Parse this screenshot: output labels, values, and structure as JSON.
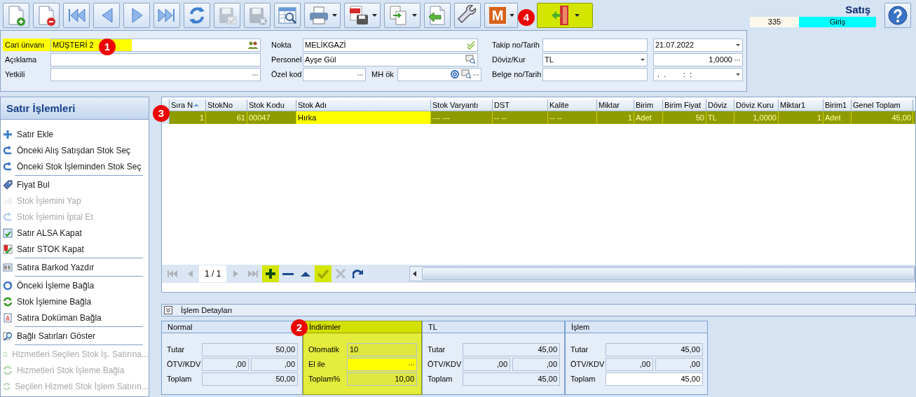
{
  "toolbar": {
    "buttons": [
      {
        "kind": "page-add",
        "disabled": false,
        "dropdown": false,
        "highlighted": false
      },
      {
        "kind": "page-remove",
        "disabled": false,
        "dropdown": false,
        "highlighted": false
      },
      {
        "kind": "first",
        "disabled": false,
        "dropdown": false,
        "highlighted": false
      },
      {
        "kind": "prev",
        "disabled": false,
        "dropdown": false,
        "highlighted": false
      },
      {
        "kind": "next",
        "disabled": false,
        "dropdown": false,
        "highlighted": false
      },
      {
        "kind": "last",
        "disabled": false,
        "dropdown": false,
        "highlighted": false
      },
      {
        "kind": "refresh",
        "disabled": false,
        "dropdown": false,
        "highlighted": false
      },
      {
        "kind": "save",
        "disabled": true,
        "dropdown": false,
        "highlighted": false
      },
      {
        "kind": "save-cancel",
        "disabled": true,
        "dropdown": false,
        "highlighted": false
      },
      {
        "kind": "table-search",
        "disabled": false,
        "dropdown": false,
        "highlighted": false
      },
      {
        "kind": "printer",
        "disabled": false,
        "dropdown": true,
        "highlighted": false
      },
      {
        "kind": "pdf",
        "disabled": false,
        "dropdown": true,
        "highlighted": false
      },
      {
        "kind": "copy",
        "disabled": false,
        "dropdown": true,
        "highlighted": false
      },
      {
        "kind": "back",
        "disabled": false,
        "dropdown": false,
        "highlighted": false
      },
      {
        "kind": "wrench",
        "disabled": false,
        "dropdown": false,
        "highlighted": false
      },
      {
        "kind": "letter",
        "text": "M",
        "disabled": false,
        "dropdown": true,
        "highlighted": false
      },
      {
        "kind": "exit",
        "disabled": false,
        "dropdown": true,
        "highlighted": true
      }
    ]
  },
  "document": {
    "title": "Satış",
    "number": "335",
    "mode": "Giriş"
  },
  "header": {
    "columns": [
      [
        [
          {
            "label": "Cari ünvanı",
            "highlighted": true,
            "inputs": [
              {
                "kind": "text",
                "value": "MÜŞTERİ 2",
                "accessories": [
                  {
                    "kind": "people"
                  }
                ]
              }
            ]
          }
        ],
        [
          {
            "label": "Açıklama",
            "highlighted": false,
            "inputs": [
              {
                "kind": "text"
              }
            ]
          }
        ],
        [
          {
            "label": "Yetkili",
            "highlighted": false,
            "inputs": [
              {
                "kind": "text",
                "accessories": [
                  {
                    "kind": "ellipsis"
                  }
                ]
              }
            ]
          }
        ]
      ],
      [
        [
          {
            "label": "Nokta",
            "highlighted": false,
            "inputs": [
              {
                "kind": "text",
                "value": "MELİKGAZİ",
                "accessories": [
                  {
                    "kind": "check"
                  }
                ]
              }
            ]
          }
        ],
        [
          {
            "label": "Personel",
            "highlighted": false,
            "inputs": [
              {
                "kind": "text",
                "value": "Ayşe Gül",
                "accessories": [
                  {
                    "kind": "card-search"
                  }
                ]
              }
            ]
          }
        ],
        [
          {
            "label": "Özel kod",
            "highlighted": false,
            "inputs": [
              {
                "kind": "text",
                "accessories": [
                  {
                    "kind": "ellipsis"
                  }
                ]
              }
            ]
          },
          {
            "label": "MH ök",
            "highlighted": false,
            "inputs": [
              {
                "kind": "text",
                "accessories": [
                  {
                    "kind": "at"
                  },
                  {
                    "kind": "card-search"
                  },
                  {
                    "kind": "ellipsis"
                  }
                ]
              }
            ]
          }
        ]
      ],
      [
        [
          {
            "label": "Takip no/Tarih",
            "highlighted": false,
            "inputs": [
              {
                "kind": "text"
              },
              {
                "kind": "text",
                "value": "21.07.2022",
                "accessories": [
                  {
                    "kind": "dropdown"
                  }
                ]
              }
            ]
          }
        ],
        [
          {
            "label": "Döviz/Kur",
            "highlighted": false,
            "inputs": [
              {
                "kind": "text",
                "value": "TL",
                "accessories": [
                  {
                    "kind": "dropdown"
                  }
                ]
              },
              {
                "kind": "number",
                "value": "1,0000",
                "accessories": [
                  {
                    "kind": "ellipsis"
                  }
                ]
              }
            ]
          }
        ],
        [
          {
            "label": "Belge no/Tarih",
            "highlighted": false,
            "inputs": [
              {
                "kind": "text"
              },
              {
                "kind": "text",
                "value": " .  .        :  :",
                "accessories": [
                  {
                    "kind": "dropdown"
                  }
                ]
              }
            ]
          }
        ]
      ]
    ]
  },
  "sidebar": {
    "title": "Satır İşlemleri",
    "items": [
      {
        "label": "Satır Ekle",
        "kind": "plus",
        "disabled": false,
        "separator_after": false
      },
      {
        "label": "Önceki Alış Satışdan Stok Seç",
        "kind": "return",
        "disabled": false,
        "separator_after": false
      },
      {
        "label": "Önceki Stok İşleminden Stok Seç",
        "kind": "return",
        "disabled": false,
        "separator_after": true
      },
      {
        "label": "Fiyat Bul",
        "kind": "tag",
        "disabled": false,
        "separator_after": false
      },
      {
        "label": "Stok İşlemini Yap",
        "kind": "forward",
        "disabled": true,
        "separator_after": false
      },
      {
        "label": "Stok İşlemini İptal Et",
        "kind": "return",
        "disabled": true,
        "separator_after": false
      },
      {
        "label": "Satır ALSA Kapat",
        "kind": "doc-check",
        "disabled": false,
        "separator_after": false
      },
      {
        "label": "Satır STOK Kapat",
        "kind": "flag-check",
        "disabled": false,
        "separator_after": true
      },
      {
        "label": "Satıra Barkod Yazdır",
        "kind": "barcode",
        "disabled": false,
        "separator_after": true
      },
      {
        "label": "Önceki İşleme Bağla",
        "kind": "cycle",
        "disabled": false,
        "separator_after": false
      },
      {
        "label": "Stok İşlemine Bağla",
        "kind": "swap",
        "disabled": false,
        "separator_after": false
      },
      {
        "label": "Satıra Doküman Bağla",
        "kind": "document",
        "disabled": false,
        "separator_after": true
      },
      {
        "label": "Bağlı Satırları Göster",
        "kind": "magnifier",
        "disabled": false,
        "separator_after": true
      },
      {
        "label": "Hizmetleri Seçilen Stok İş. Satırına...",
        "kind": "swap",
        "disabled": true,
        "separator_after": false
      },
      {
        "label": "Hizmetleri Stok İşleme Bağla",
        "kind": "swap",
        "disabled": true,
        "separator_after": false
      },
      {
        "label": "Seçilen Hizmeti Stok İşlem Satırın...",
        "kind": "swap",
        "disabled": true,
        "separator_after": false
      }
    ]
  },
  "grid": {
    "columns": [
      {
        "label": "Sıra N",
        "sorted": true
      },
      {
        "label": "StokNo",
        "sorted": false
      },
      {
        "label": "Stok Kodu",
        "sorted": false
      },
      {
        "label": "Stok Adı",
        "sorted": false
      },
      {
        "label": "Stok Varyantı",
        "sorted": false
      },
      {
        "label": "DST",
        "sorted": false
      },
      {
        "label": "Kalite",
        "sorted": false
      },
      {
        "label": "Miktar",
        "sorted": false
      },
      {
        "label": "Birim",
        "sorted": false
      },
      {
        "label": "Birim Fiyat",
        "sorted": false
      },
      {
        "label": "Döviz",
        "sorted": false
      },
      {
        "label": "Döviz Kuru",
        "sorted": false
      },
      {
        "label": "Miktar1",
        "sorted": false
      },
      {
        "label": "Birim1",
        "sorted": false
      },
      {
        "label": "Genel Toplam",
        "sorted": false
      }
    ],
    "rows": [
      {
        "selected": true,
        "cells": [
          {
            "text": "1",
            "focused": false
          },
          {
            "text": "61",
            "focused": false
          },
          {
            "text": "00047",
            "focused": false
          },
          {
            "text": "Hırka",
            "focused": true
          },
          {
            "text": "--- ---",
            "focused": false
          },
          {
            "text": "-- --",
            "focused": false
          },
          {
            "text": "-- --",
            "focused": false
          },
          {
            "text": "1",
            "focused": false
          },
          {
            "text": "Adet",
            "focused": false
          },
          {
            "text": "50",
            "focused": false
          },
          {
            "text": "TL",
            "focused": false
          },
          {
            "text": "1,0000",
            "focused": false
          },
          {
            "text": "1",
            "focused": false
          },
          {
            "text": "Adet",
            "focused": false
          },
          {
            "text": "45,00",
            "focused": false
          }
        ]
      }
    ],
    "navigator": {
      "page": "1 / 1",
      "buttons": [
        {
          "kind": "first",
          "disabled": true,
          "highlighted": false
        },
        {
          "kind": "prev",
          "disabled": true,
          "highlighted": false
        },
        {
          "kind": "page"
        },
        {
          "kind": "next",
          "disabled": true,
          "highlighted": false
        },
        {
          "kind": "last",
          "disabled": true,
          "highlighted": false
        },
        {
          "kind": "add",
          "disabled": false,
          "highlighted": true
        },
        {
          "kind": "remove",
          "disabled": false,
          "highlighted": false
        },
        {
          "kind": "up",
          "disabled": false,
          "highlighted": false
        },
        {
          "kind": "check",
          "disabled": false,
          "highlighted": true
        },
        {
          "kind": "cancel",
          "disabled": true,
          "highlighted": false
        },
        {
          "kind": "redo",
          "disabled": false,
          "highlighted": false
        }
      ]
    }
  },
  "details": {
    "title": "İşlem Detayları",
    "panels": [
      {
        "title": "Normal",
        "highlighted": false,
        "fields": [
          {
            "label": "Tutar",
            "values": [
              {
                "value": "50,00",
                "editable": false
              }
            ]
          },
          {
            "label": "ÖTV/KDV",
            "values": [
              {
                "value": ",00",
                "editable": false
              },
              {
                "value": ",00",
                "editable": false
              }
            ]
          },
          {
            "label": "Toplam",
            "values": [
              {
                "value": "50,00",
                "editable": false
              }
            ]
          }
        ]
      },
      {
        "title": "İndirimler",
        "highlighted": true,
        "fields": [
          {
            "label": "Otomatik",
            "values": [
              {
                "value": "10",
                "editable": false
              }
            ]
          },
          {
            "label": "El ile",
            "values": [
              {
                "focused": true,
                "ellipsis": true
              }
            ]
          },
          {
            "label": "Toplam%",
            "values": [
              {
                "value": "10,00",
                "editable": false
              }
            ]
          }
        ]
      },
      {
        "title": "TL",
        "highlighted": false,
        "fields": [
          {
            "label": "Tutar",
            "values": [
              {
                "value": "45,00",
                "editable": false
              }
            ]
          },
          {
            "label": "ÖTV/KDV",
            "values": [
              {
                "value": ",00",
                "editable": false
              },
              {
                "value": ",00",
                "editable": false
              }
            ]
          },
          {
            "label": "Toplam",
            "values": [
              {
                "value": "45,00",
                "editable": false
              }
            ]
          }
        ]
      },
      {
        "title": "İşlem",
        "highlighted": false,
        "fields": [
          {
            "label": "Tutar",
            "values": [
              {
                "value": "45,00",
                "editable": false
              }
            ]
          },
          {
            "label": "ÖTV/KDV",
            "values": [
              {
                "value": ",00",
                "editable": false
              },
              {
                "value": ",00",
                "editable": false
              }
            ]
          },
          {
            "label": "Toplam",
            "values": [
              {
                "value": "45,00",
                "editable": true
              }
            ]
          }
        ]
      }
    ]
  },
  "callouts": [
    {
      "number": "1"
    },
    {
      "number": "2"
    },
    {
      "number": "3"
    },
    {
      "number": "4"
    }
  ]
}
